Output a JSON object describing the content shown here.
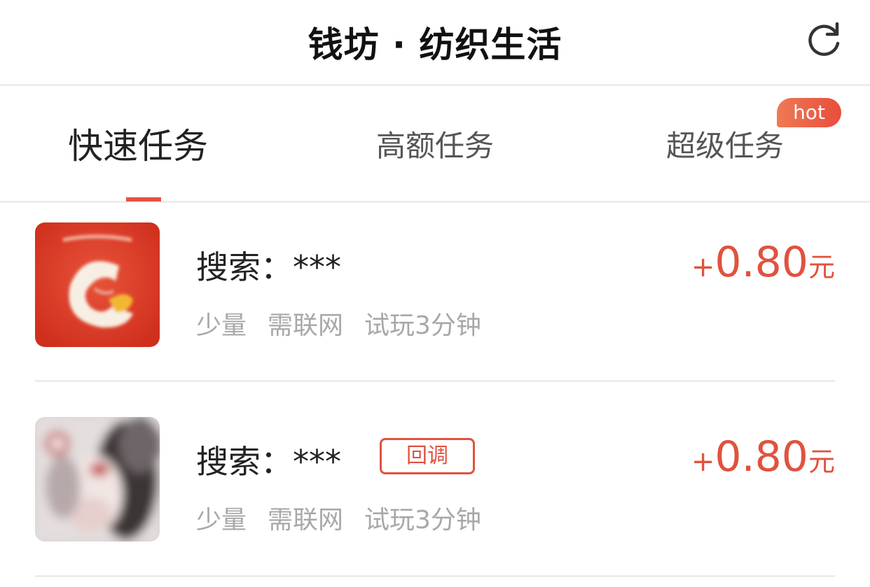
{
  "header": {
    "title": "钱坊 · 纺织生活",
    "refresh_icon": "refresh-icon"
  },
  "tabs": [
    {
      "label": "快速任务",
      "active": true
    },
    {
      "label": "高额任务",
      "active": false
    },
    {
      "label": "超级任务",
      "active": false,
      "badge": "hot"
    }
  ],
  "colors": {
    "accent": "#e0523f",
    "badge": "#eb6246"
  },
  "tasks": [
    {
      "title": "搜索：***",
      "tags": [
        "少量",
        "需联网",
        "试玩3分钟"
      ],
      "reward_plus": "+",
      "reward_amount": "0.80",
      "reward_unit": "元",
      "icon": "app-icon-red"
    },
    {
      "title": "搜索：***",
      "badge": "回调",
      "tags": [
        "少量",
        "需联网",
        "试玩3分钟"
      ],
      "reward_plus": "+",
      "reward_amount": "0.80",
      "reward_unit": "元",
      "icon": "app-icon-photo"
    }
  ]
}
